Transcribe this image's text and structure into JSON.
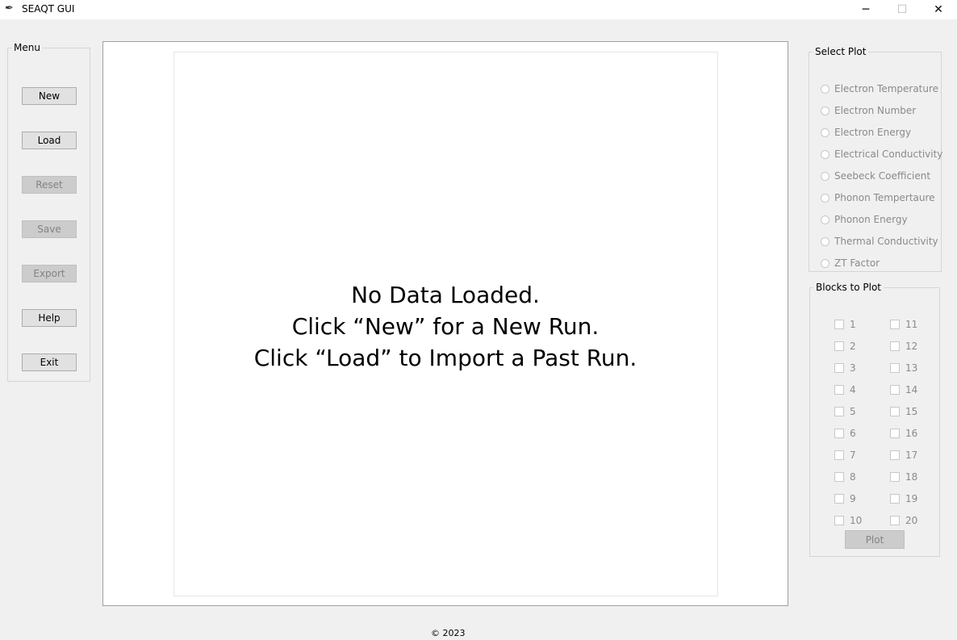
{
  "window": {
    "title": "SEAQT GUI",
    "app_icon": "feather-icon",
    "minimize_glyph": "─",
    "maximize_glyph": "☐",
    "close_glyph": "✕"
  },
  "menu": {
    "legend": "Menu",
    "buttons": [
      {
        "label": "New",
        "enabled": true
      },
      {
        "label": "Load",
        "enabled": true
      },
      {
        "label": "Reset",
        "enabled": false
      },
      {
        "label": "Save",
        "enabled": false
      },
      {
        "label": "Export",
        "enabled": false
      },
      {
        "label": "Help",
        "enabled": true
      },
      {
        "label": "Exit",
        "enabled": true
      }
    ]
  },
  "canvas": {
    "message_lines": [
      "No Data Loaded.",
      "Click “New” for a New Run.",
      "Click “Load” to Import a Past Run."
    ]
  },
  "select_plot": {
    "legend": "Select Plot",
    "options": [
      "Electron Temperature",
      "Electron Number",
      "Electron Energy",
      "Electrical Conductivity",
      "Seebeck Coefficient",
      "Phonon Tempertaure",
      "Phonon Energy",
      "Thermal Conductivity",
      "ZT Factor"
    ]
  },
  "blocks": {
    "legend": "Blocks to Plot",
    "items": [
      "1",
      "2",
      "3",
      "4",
      "5",
      "6",
      "7",
      "8",
      "9",
      "10",
      "11",
      "12",
      "13",
      "14",
      "15",
      "16",
      "17",
      "18",
      "19",
      "20"
    ],
    "plot_label": "Plot"
  },
  "footer": {
    "copyright": "© 2023"
  }
}
